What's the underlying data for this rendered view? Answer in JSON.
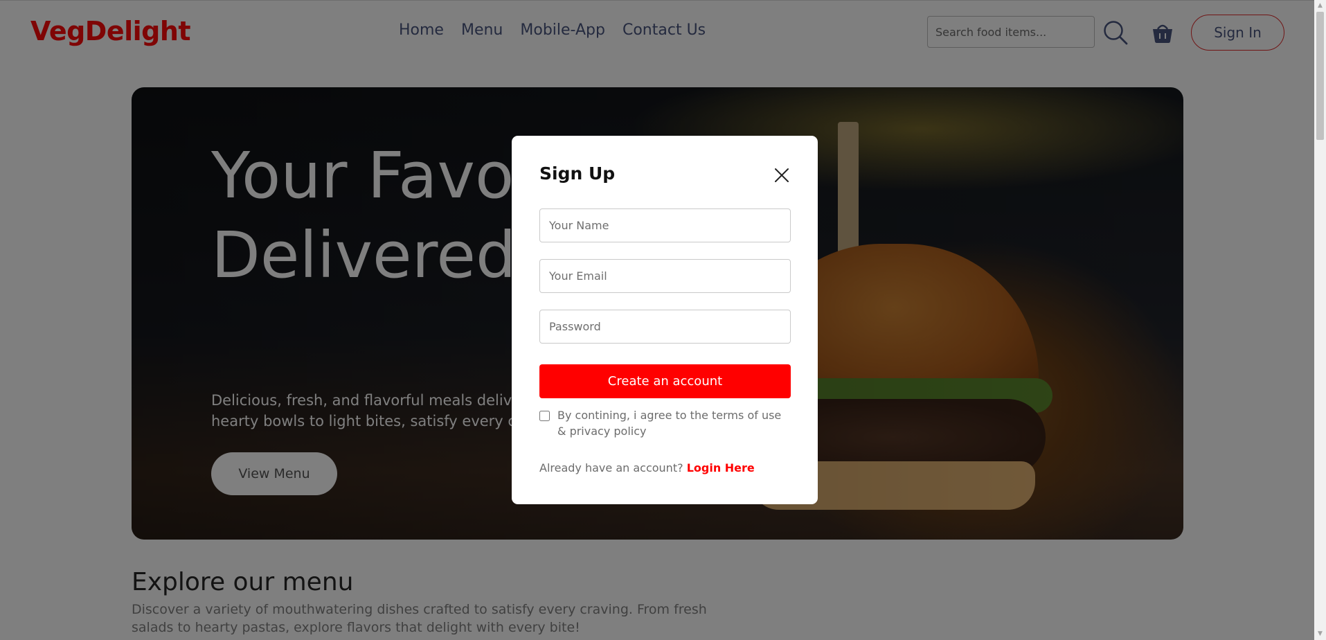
{
  "navbar": {
    "logo": "VegDelight",
    "links": [
      "Home",
      "Menu",
      "Mobile-App",
      "Contact Us"
    ],
    "search_placeholder": "Search food items...",
    "sign_in_label": "Sign In"
  },
  "hero": {
    "title": "Your Favorite Food, Delivered Fast!",
    "description": "Delicious, fresh, and flavorful meals delivered to your door. From hearty bowls to light bites, satisfy every craving.",
    "button_label": "View Menu"
  },
  "explore": {
    "title": "Explore our menu",
    "description": "Discover a variety of mouthwatering dishes crafted to satisfy every craving. From fresh salads to hearty pastas, explore flavors that delight with every bite!"
  },
  "modal": {
    "title": "Sign Up",
    "name_placeholder": "Your Name",
    "email_placeholder": "Your Email",
    "password_placeholder": "Password",
    "submit_label": "Create an account",
    "terms_text": "By contining, i agree to the terms of use & privacy policy",
    "login_prompt": "Already have an account?",
    "login_link": "Login Here"
  },
  "colors": {
    "brand": "#ff0b0b",
    "nav_text": "#49557e",
    "accent_button": "#ff0000"
  },
  "icons": [
    "search-icon",
    "basket-icon",
    "close-icon"
  ]
}
